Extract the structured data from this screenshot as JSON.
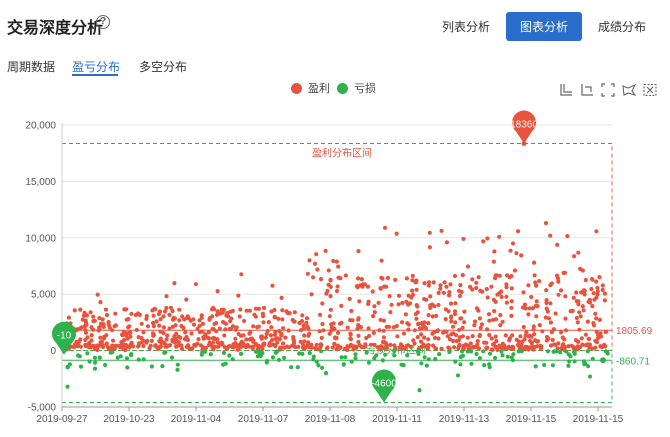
{
  "header": {
    "title": "交易深度分析",
    "help_icon": "?"
  },
  "view_tabs": [
    {
      "label": "列表分析",
      "active": false
    },
    {
      "label": "图表分析",
      "active": true
    },
    {
      "label": "成绩分布",
      "active": false
    }
  ],
  "sub_tabs": [
    {
      "label": "周期数据",
      "active": false
    },
    {
      "label": "盈亏分布",
      "active": true
    },
    {
      "label": "多空分布",
      "active": false
    }
  ],
  "colors": {
    "profit": "#e8533e",
    "loss": "#2eb24b",
    "accent": "#2a6ecc"
  },
  "toolbox": [
    "zoom-icon",
    "zoom-reset-icon",
    "fullscreen-icon",
    "lasso-icon",
    "clear-selection-icon"
  ],
  "chart_data": {
    "type": "scatter",
    "series": [
      {
        "name": "盈利",
        "color": "#e8533e"
      },
      {
        "name": "亏损",
        "color": "#2eb24b"
      }
    ],
    "x_ticks": [
      "2019-09-27",
      "2019-10-23",
      "2019-11-04",
      "2019-11-07",
      "2019-11-08",
      "2019-11-11",
      "2019-11-13",
      "2019-11-15",
      "2019-11-15"
    ],
    "y_ticks": [
      "20,000",
      "15,000",
      "10,000",
      "5,000",
      "0",
      "-5,000"
    ],
    "ylim": [
      -5000,
      20000
    ],
    "grid": true,
    "profit_zone_label": "盈利分布区间",
    "loss_zone_label": "亏损分布区间",
    "profit_zone_max": 18360,
    "loss_zone_min": -4600,
    "profit_avg": 1805.69,
    "loss_avg": -860.71,
    "markers": [
      {
        "label": "18360",
        "value": 18360,
        "type": "max-profit"
      },
      {
        "label": "-10",
        "value": -10,
        "type": "first"
      },
      {
        "label": "-4600",
        "value": -4600,
        "type": "max-loss"
      }
    ],
    "avg_labels": {
      "profit": "1805.69",
      "loss": "-860.71"
    }
  }
}
